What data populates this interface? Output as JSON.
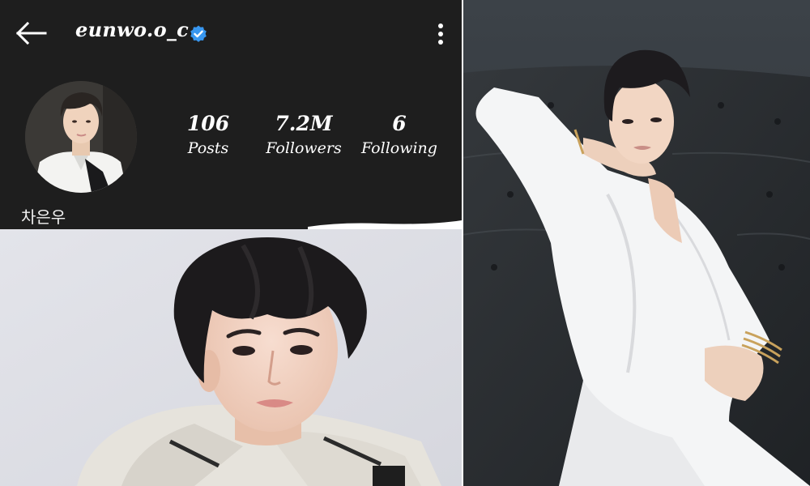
{
  "profile": {
    "username": "eunwo.o_c",
    "verified": true,
    "display_name": "차은우",
    "stats": [
      {
        "value": "106",
        "label": "Posts"
      },
      {
        "value": "7.2M",
        "label": "Followers"
      },
      {
        "value": "6",
        "label": "Following"
      }
    ],
    "icons": {
      "back": "back-arrow-icon",
      "verified": "verified-badge-icon",
      "more": "more-options-icon"
    }
  },
  "colors": {
    "panel_background": "#1e1e1e",
    "text": "#ffffff",
    "verified_badge": "#3897f0"
  }
}
